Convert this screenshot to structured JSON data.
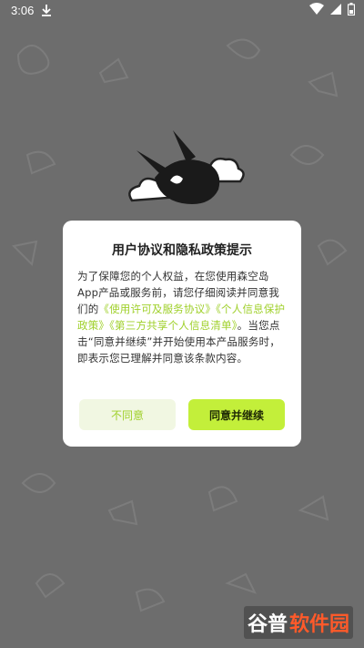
{
  "status_bar": {
    "time": "3:06",
    "icons": [
      "download-icon",
      "wifi-icon",
      "signal-icon",
      "battery-icon"
    ]
  },
  "dialog": {
    "title": "用户协议和隐私政策提示",
    "body_text_1": "为了保障您的个人权益，在您使用森空岛App产品或服务前，请您仔细阅读并同意我们的",
    "link_1": "《使用许可及服务协议》",
    "link_2": "《个人信息保护政策》",
    "link_3": "《第三方共享个人信息清单》",
    "body_text_2": "。当您点击“同意并继续”并开始使用本产品服务时，即表示您已理解并同意该条款内容。",
    "decline_label": "不同意",
    "accept_label": "同意并继续"
  },
  "watermark": {
    "text_part1": "谷普",
    "text_part2": "软件园"
  },
  "colors": {
    "background": "#6d6d6d",
    "link": "#9fd02a",
    "accept_button": "#c3ef3a",
    "decline_button": "#f1f7e2"
  }
}
